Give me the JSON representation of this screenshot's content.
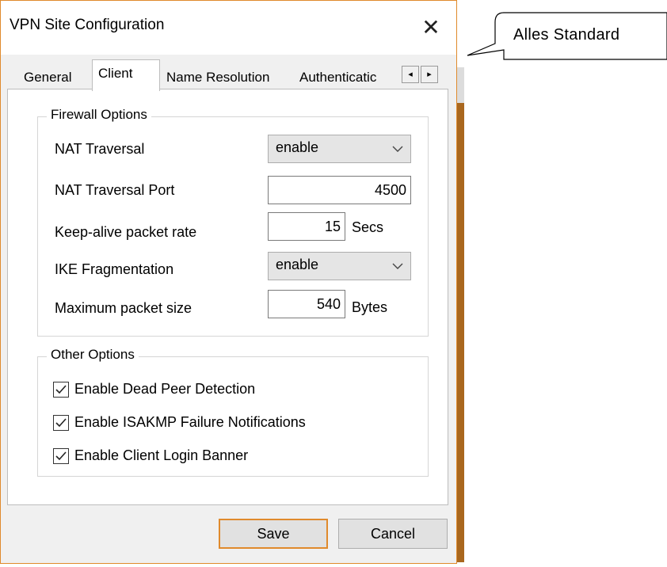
{
  "window": {
    "title": "VPN Site Configuration",
    "close_glyph": "✕"
  },
  "tabs": [
    {
      "label": "General",
      "active": false
    },
    {
      "label": "Client",
      "active": true
    },
    {
      "label": "Name Resolution",
      "active": false
    },
    {
      "label": "Authenticatic",
      "active": false
    }
  ],
  "tab_scroll": {
    "left": "◂",
    "right": "▸"
  },
  "firewall": {
    "legend": "Firewall Options",
    "nat_traversal": {
      "label": "NAT Traversal",
      "value": "enable"
    },
    "nat_traversal_port": {
      "label": "NAT Traversal Port",
      "value": "4500"
    },
    "keepalive": {
      "label": "Keep-alive packet rate",
      "value": "15",
      "unit": "Secs"
    },
    "ike_fragmentation": {
      "label": "IKE Fragmentation",
      "value": "enable"
    },
    "max_packet": {
      "label": "Maximum packet size",
      "value": "540",
      "unit": "Bytes"
    }
  },
  "other": {
    "legend": "Other Options",
    "options": [
      {
        "label": "Enable Dead Peer Detection",
        "checked": true
      },
      {
        "label": "Enable ISAKMP Failure Notifications",
        "checked": true
      },
      {
        "label": "Enable Client Login Banner",
        "checked": true
      }
    ]
  },
  "buttons": {
    "save": "Save",
    "cancel": "Cancel"
  },
  "callout": {
    "text": "Alles Standard"
  },
  "colors": {
    "accent": "#e08a2c",
    "background_strip": "#a9671e"
  }
}
